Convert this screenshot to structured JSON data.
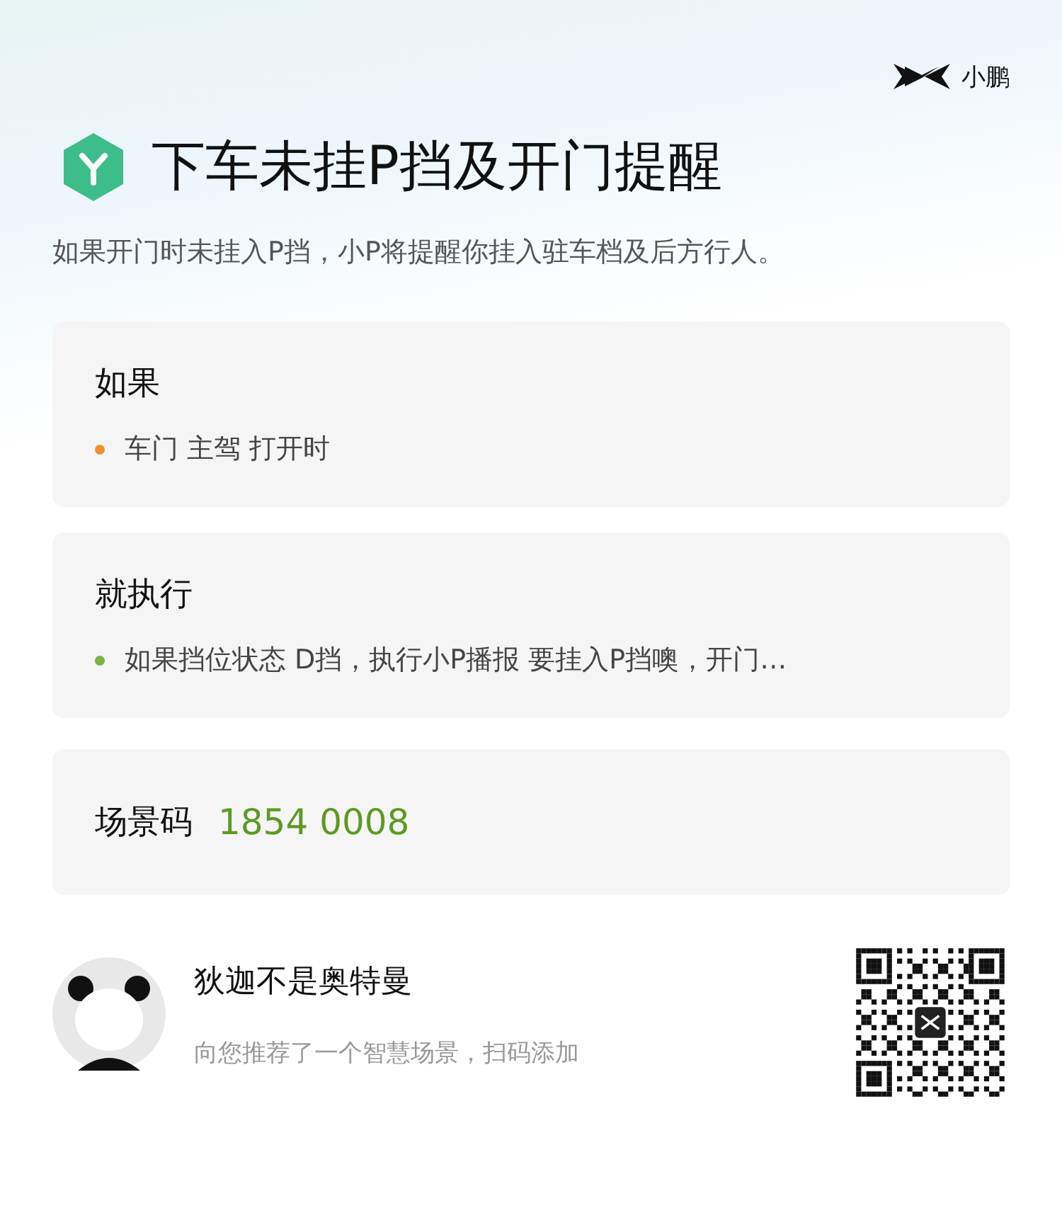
{
  "brand": {
    "name": "小鹏"
  },
  "header": {
    "title": "下车未挂P挡及开门提醒",
    "description": "如果开门时未挂入P挡，小P将提醒你挂入驻车档及后方行人。"
  },
  "sections": [
    {
      "kind": "list",
      "title": "如果",
      "items": [
        {
          "text": "车门 主驾 打开时",
          "color": "#f0902c"
        }
      ]
    },
    {
      "kind": "list",
      "title": "就执行",
      "items": [
        {
          "text": "如果挡位状态 D挡，执行小P播报 要挂入P挡噢，开门…",
          "color": "#7cb342"
        }
      ]
    },
    {
      "kind": "code",
      "title": "场景码",
      "value": "1854 0008"
    }
  ],
  "footer": {
    "user_name": "狄迦不是奥特曼",
    "message": "向您推荐了一个智慧场景，扫码添加"
  }
}
